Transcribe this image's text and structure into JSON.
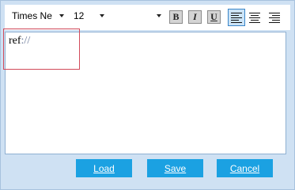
{
  "toolbar": {
    "font_family": "Times Ne",
    "font_size": "12",
    "font_color": "",
    "bold_label": "B",
    "italic_label": "I",
    "underline_label": "U",
    "align_active": "left"
  },
  "editor": {
    "content_prefix": "ref",
    "content_sep": "://"
  },
  "buttons": {
    "load_label": "Load",
    "save_label": "Save",
    "cancel_label": "Cancel"
  },
  "colors": {
    "frame_bg": "#cfe1f3",
    "accent_button": "#1ba1e2",
    "ref_highlight": "#d24a5a",
    "active_align": "#cce4f7"
  }
}
